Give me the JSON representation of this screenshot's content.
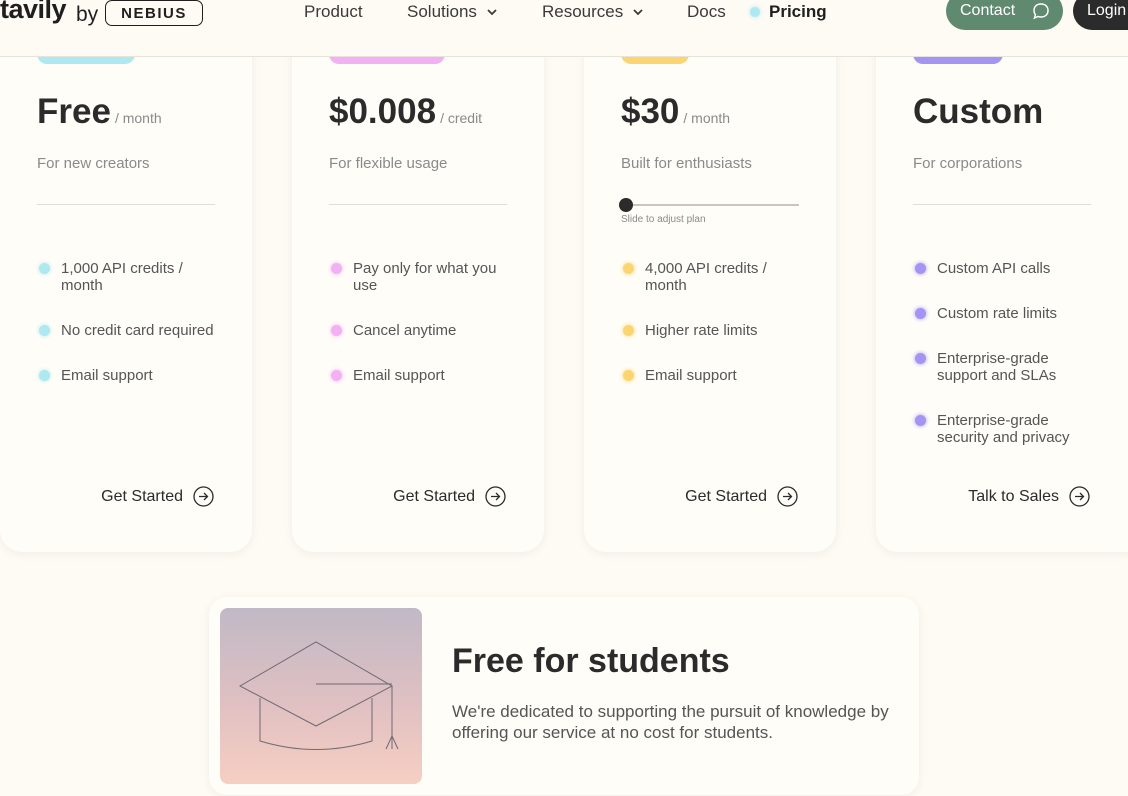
{
  "header": {
    "logo_word": "tavily",
    "logo_by": "by",
    "logo_partner": "NEBIUS",
    "nav": [
      "Product",
      "Solutions",
      "Resources",
      "Docs",
      "Pricing"
    ],
    "contact_label": "Contact",
    "login_label": "Login"
  },
  "plans": [
    {
      "price": "Free",
      "unit": "/ month",
      "subtitle": "For new creators",
      "accent": "#aee8f0",
      "features": [
        "1,000 API credits / month",
        "No credit card required",
        "Email support"
      ],
      "cta": "Get Started"
    },
    {
      "price": "$0.008",
      "unit": "/ credit",
      "subtitle": "For flexible usage",
      "accent": "#f2b1f3",
      "features": [
        "Pay only for what you use",
        "Cancel anytime",
        "Email support"
      ],
      "cta": "Get Started"
    },
    {
      "price": "$30",
      "unit": "/ month",
      "subtitle": "Built for enthusiasts",
      "accent": "#fcd573",
      "slider_hint": "Slide to adjust plan",
      "slider_value": 0,
      "features": [
        "4,000 API credits / month",
        "Higher rate limits",
        "Email support"
      ],
      "cta": "Get Started"
    },
    {
      "price": "Custom",
      "unit": "",
      "subtitle": "For corporations",
      "accent": "#a494f4",
      "features": [
        "Custom API calls",
        "Custom rate limits",
        "Enterprise-grade support and SLAs",
        "Enterprise-grade security and privacy"
      ],
      "cta": "Talk to Sales"
    }
  ],
  "students": {
    "title": "Free for students",
    "text": "We're dedicated to supporting the pursuit of knowledge by offering our service at no cost for students."
  }
}
